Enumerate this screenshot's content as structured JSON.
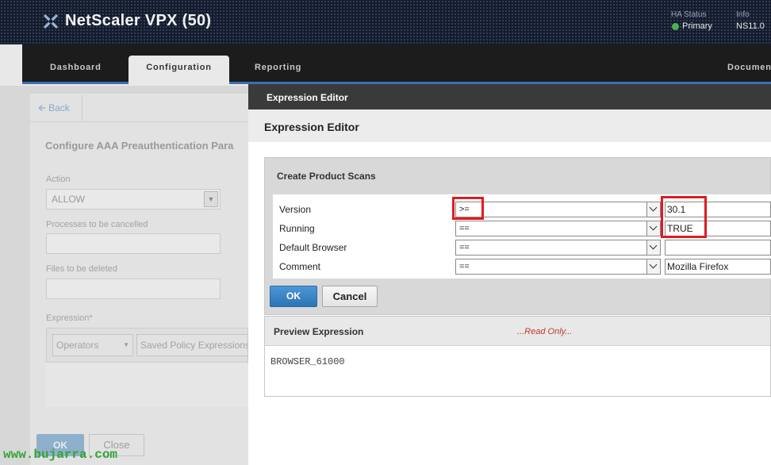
{
  "header": {
    "app_title": "NetScaler VPX (50)",
    "ha_status_label": "HA Status",
    "ha_status_value": "Primary",
    "info_label": "Info",
    "info_value": "NS11.0"
  },
  "nav": {
    "tabs": [
      "Dashboard",
      "Configuration",
      "Reporting",
      "Documen"
    ],
    "active_tab": "Configuration"
  },
  "background_page": {
    "back_label": "Back",
    "heading": "Configure AAA Preauthentication Para",
    "action_label": "Action",
    "action_value": "ALLOW",
    "processes_label": "Processes to be cancelled",
    "files_label": "Files to be deleted",
    "expression_label": "Expression*",
    "operators_label": "Operators",
    "saved_label": "Saved Policy Expressions",
    "ok_label": "OK",
    "close_label": "Close"
  },
  "watermark": "www.bujarra.com",
  "modal": {
    "title": "Expression Editor",
    "header": "Expression Editor",
    "section_heading": "Create Product Scans",
    "rows": [
      {
        "label": "Version",
        "operator": ">=",
        "value": "30.1"
      },
      {
        "label": "Running",
        "operator": "==",
        "value": "TRUE"
      },
      {
        "label": "Default Browser",
        "operator": "==",
        "value": ""
      },
      {
        "label": "Comment",
        "operator": "==",
        "value": "Mozilla Firefox"
      }
    ],
    "ok_label": "OK",
    "cancel_label": "Cancel",
    "preview_title": "Preview Expression",
    "preview_readonly": "...Read Only...",
    "preview_text": "BROWSER_61000"
  },
  "colors": {
    "accent_blue": "#3b6fb1",
    "ok_button": "#2c74b4",
    "highlight_red": "#e01a22",
    "status_green": "#4caf50"
  }
}
